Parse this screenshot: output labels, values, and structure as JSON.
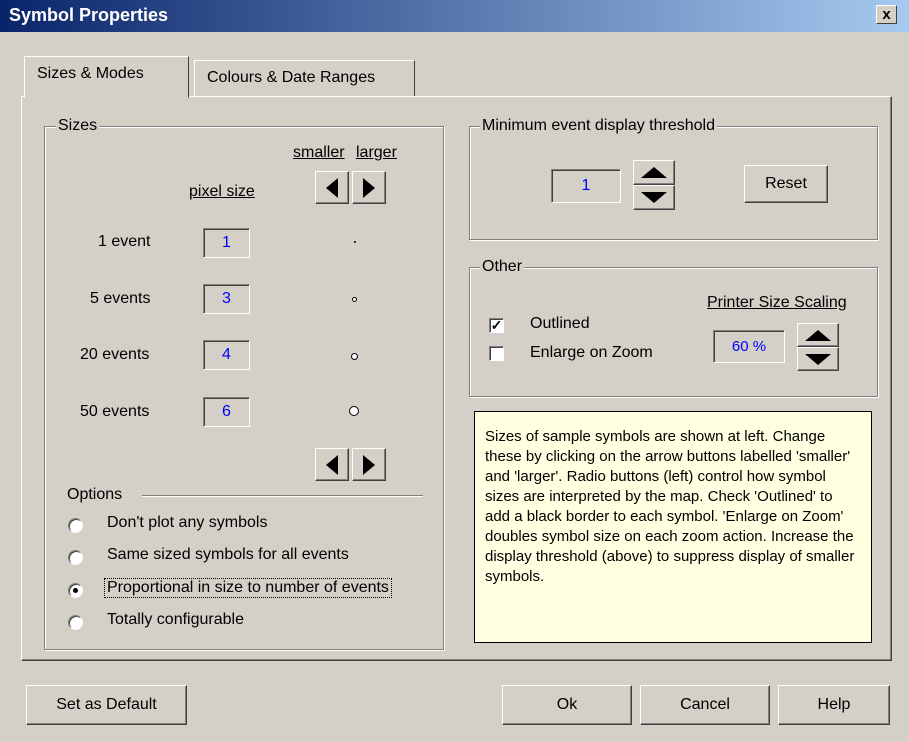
{
  "window": {
    "title": "Symbol Properties",
    "close_label": "x"
  },
  "tabs": [
    {
      "label": "Sizes & Modes",
      "active": true
    },
    {
      "label": "Colours & Date Ranges",
      "active": false
    }
  ],
  "sizes": {
    "group_label": "Sizes",
    "smaller_label": "smaller",
    "larger_label": "larger",
    "pixel_size_label": "pixel size",
    "rows": [
      {
        "label": "1 event",
        "value": "1"
      },
      {
        "label": "5 events",
        "value": "3"
      },
      {
        "label": "20 events",
        "value": "4"
      },
      {
        "label": "50 events",
        "value": "6"
      }
    ]
  },
  "options": {
    "label": "Options",
    "items": [
      {
        "label": "Don't plot any symbols",
        "selected": false
      },
      {
        "label": "Same sized symbols for all events",
        "selected": false
      },
      {
        "label": "Proportional in size to number of events",
        "selected": true
      },
      {
        "label": "Totally configurable",
        "selected": false
      }
    ]
  },
  "threshold": {
    "group_label": "Minimum event display threshold",
    "value": "1",
    "reset_label": "Reset"
  },
  "other": {
    "group_label": "Other",
    "outlined_label": "Outlined",
    "outlined_checked": true,
    "enlarge_label": "Enlarge on Zoom",
    "enlarge_checked": false,
    "printer_label": "Printer Size Scaling",
    "printer_value": "60 %"
  },
  "help_note": "Sizes of sample symbols are shown at left. Change these by clicking on the arrow buttons labelled 'smaller' and 'larger'.  Radio buttons (left) control how symbol sizes are interpreted by the map.  Check 'Outlined' to add a black border to each symbol.   'Enlarge on Zoom' doubles symbol size on each zoom action. Increase the display threshold (above) to suppress display of smaller symbols.",
  "buttons": {
    "set_default": "Set as Default",
    "ok": "Ok",
    "cancel": "Cancel",
    "help": "Help"
  },
  "colors": {
    "title_start": "#0a246a",
    "title_end": "#a6caf0",
    "value_blue": "#0000ff",
    "note_bg": "#ffffe1",
    "face": "#d4d0c8"
  }
}
